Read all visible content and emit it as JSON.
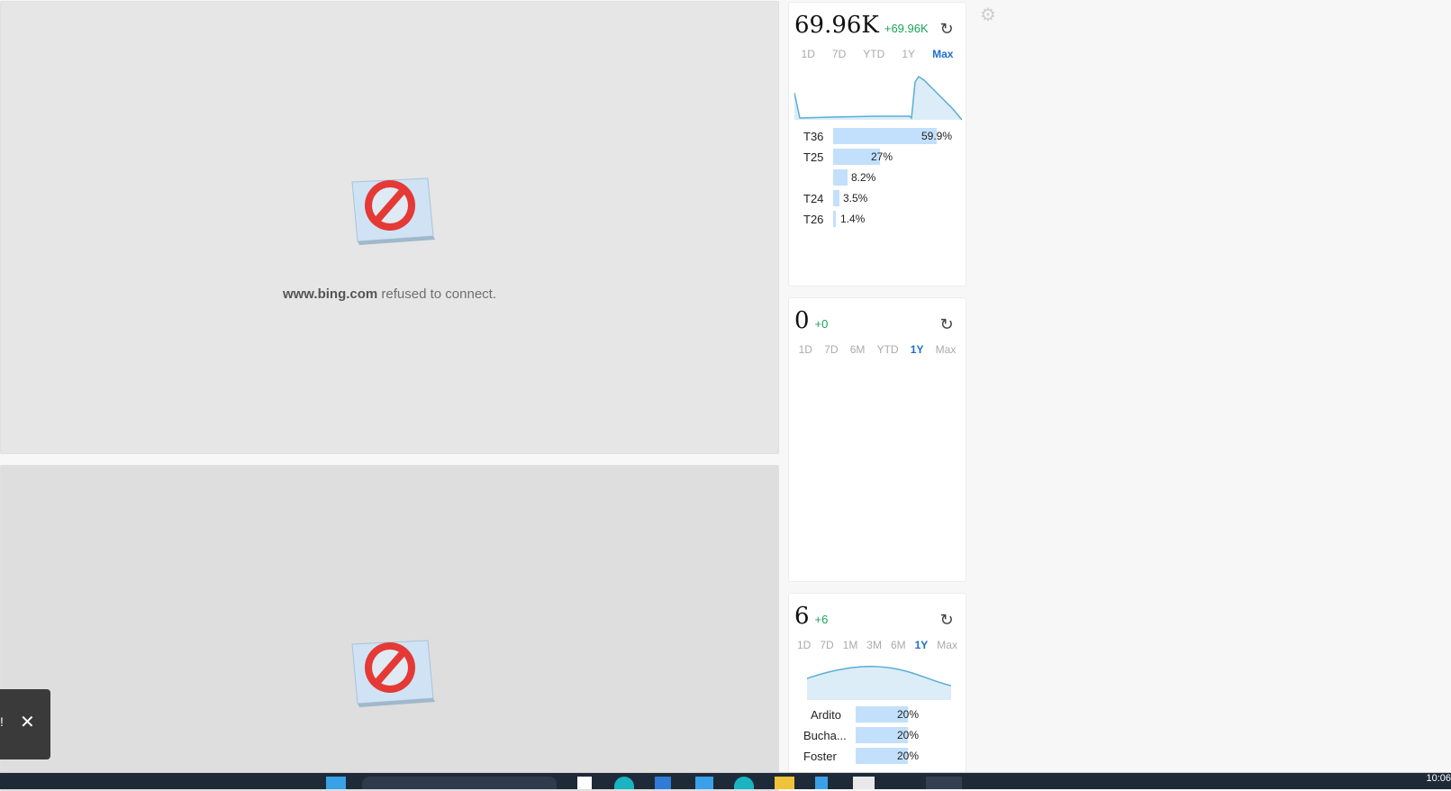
{
  "iframes": {
    "top": {
      "refused_host": "www.bing.com",
      "refused_text": "refused to connect."
    }
  },
  "cards": [
    {
      "value": "69.96K",
      "delta": "+69.96K",
      "ranges": [
        "1D",
        "7D",
        "YTD",
        "1Y",
        "Max"
      ],
      "active_range": "Max",
      "bars": [
        {
          "label": "T36",
          "pct_text": "59.9%",
          "pct": 59.9
        },
        {
          "label": "T25",
          "pct_text": "27%",
          "pct": 27
        },
        {
          "label": "",
          "pct_text": "8.2%",
          "pct": 8.2
        },
        {
          "label": "T24",
          "pct_text": "3.5%",
          "pct": 3.5
        },
        {
          "label": "T26",
          "pct_text": "1.4%",
          "pct": 1.4
        }
      ]
    },
    {
      "value": "0",
      "delta": "+0",
      "ranges": [
        "1D",
        "7D",
        "6M",
        "YTD",
        "1Y",
        "Max"
      ],
      "active_range": "1Y",
      "bars": []
    },
    {
      "value": "6",
      "delta": "+6",
      "ranges": [
        "1D",
        "7D",
        "1M",
        "3M",
        "6M",
        "1Y",
        "Max"
      ],
      "active_range": "1Y",
      "bars": [
        {
          "label": "Ardito",
          "pct_text": "20%",
          "pct": 20
        },
        {
          "label": "Bucha...",
          "pct_text": "20%",
          "pct": 20
        },
        {
          "label": "Foster",
          "pct_text": "20%",
          "pct": 20
        }
      ]
    }
  ],
  "icons": {
    "refresh": "refresh-icon",
    "gear": "gear-icon",
    "close": "close-icon",
    "blocked": "blocked-icon"
  },
  "colors": {
    "accent": "#1f6fd1",
    "positive": "#1aa35a",
    "bar": "#c2e0fb",
    "spark_line": "#5aaed6",
    "spark_fill": "#dcedf7"
  },
  "toast": {
    "text": "!"
  },
  "taskbar": {
    "clock": "10:06"
  }
}
